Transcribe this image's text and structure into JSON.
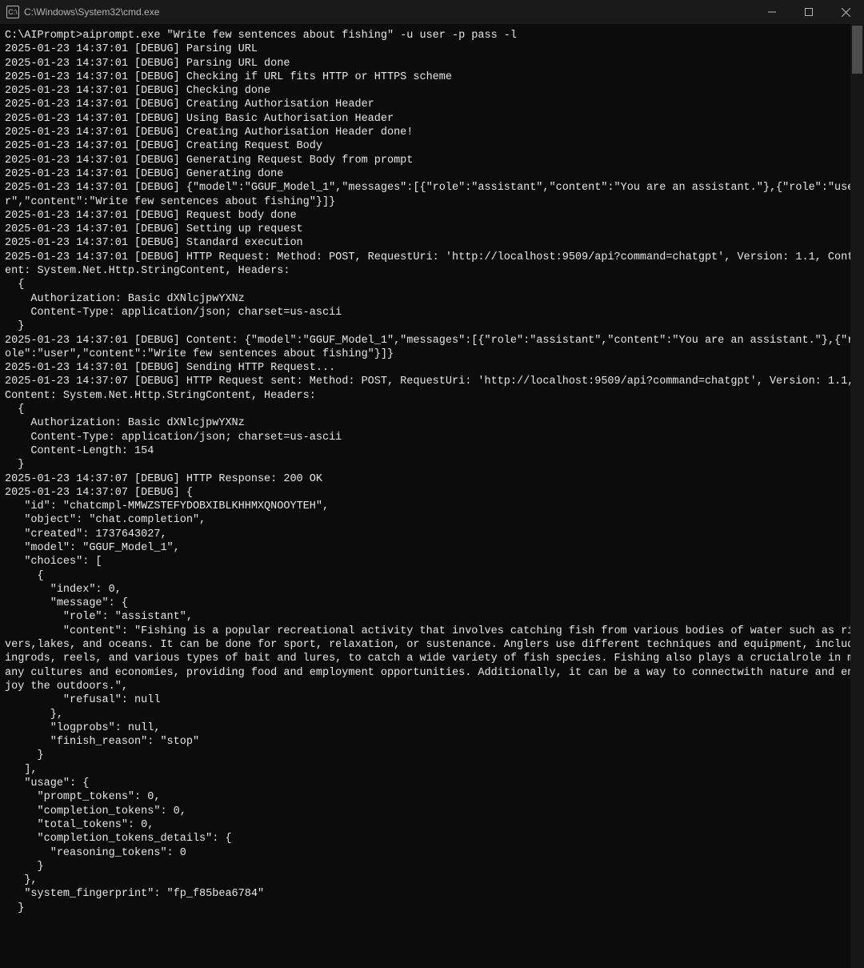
{
  "window": {
    "title": "C:\\Windows\\System32\\cmd.exe",
    "icon_label": "cmd-icon"
  },
  "terminal": {
    "content": "C:\\AIPrompt>aiprompt.exe \"Write few sentences about fishing\" -u user -p pass -l\n2025-01-23 14:37:01 [DEBUG] Parsing URL\n2025-01-23 14:37:01 [DEBUG] Parsing URL done\n2025-01-23 14:37:01 [DEBUG] Checking if URL fits HTTP or HTTPS scheme\n2025-01-23 14:37:01 [DEBUG] Checking done\n2025-01-23 14:37:01 [DEBUG] Creating Authorisation Header\n2025-01-23 14:37:01 [DEBUG] Using Basic Authorisation Header\n2025-01-23 14:37:01 [DEBUG] Creating Authorisation Header done!\n2025-01-23 14:37:01 [DEBUG] Creating Request Body\n2025-01-23 14:37:01 [DEBUG] Generating Request Body from prompt\n2025-01-23 14:37:01 [DEBUG] Generating done\n2025-01-23 14:37:01 [DEBUG] {\"model\":\"GGUF_Model_1\",\"messages\":[{\"role\":\"assistant\",\"content\":\"You are an assistant.\"},{\"role\":\"user\",\"content\":\"Write few sentences about fishing\"}]}\n2025-01-23 14:37:01 [DEBUG] Request body done\n2025-01-23 14:37:01 [DEBUG] Setting up request\n2025-01-23 14:37:01 [DEBUG] Standard execution\n2025-01-23 14:37:01 [DEBUG] HTTP Request: Method: POST, RequestUri: 'http://localhost:9509/api?command=chatgpt', Version: 1.1, Content: System.Net.Http.StringContent, Headers:\n  {\n    Authorization: Basic dXNlcjpwYXNz\n    Content-Type: application/json; charset=us-ascii\n  }\n2025-01-23 14:37:01 [DEBUG] Content: {\"model\":\"GGUF_Model_1\",\"messages\":[{\"role\":\"assistant\",\"content\":\"You are an assistant.\"},{\"role\":\"user\",\"content\":\"Write few sentences about fishing\"}]}\n2025-01-23 14:37:01 [DEBUG] Sending HTTP Request...\n2025-01-23 14:37:07 [DEBUG] HTTP Request sent: Method: POST, RequestUri: 'http://localhost:9509/api?command=chatgpt', Version: 1.1, Content: System.Net.Http.StringContent, Headers:\n  {\n    Authorization: Basic dXNlcjpwYXNz\n    Content-Type: application/json; charset=us-ascii\n    Content-Length: 154\n  }\n2025-01-23 14:37:07 [DEBUG] HTTP Response: 200 OK\n2025-01-23 14:37:07 [DEBUG] {\n   \"id\": \"chatcmpl-MMWZSTEFYDOBXIBLKHHMXQNOOYTEH\",\n   \"object\": \"chat.completion\",\n   \"created\": 1737643027,\n   \"model\": \"GGUF_Model_1\",\n   \"choices\": [\n     {\n       \"index\": 0,\n       \"message\": {\n         \"role\": \"assistant\",\n         \"content\": \"Fishing is a popular recreational activity that involves catching fish from various bodies of water such as rivers,lakes, and oceans. It can be done for sport, relaxation, or sustenance. Anglers use different techniques and equipment, includingrods, reels, and various types of bait and lures, to catch a wide variety of fish species. Fishing also plays a crucialrole in many cultures and economies, providing food and employment opportunities. Additionally, it can be a way to connectwith nature and enjoy the outdoors.\",\n         \"refusal\": null\n       },\n       \"logprobs\": null,\n       \"finish_reason\": \"stop\"\n     }\n   ],\n   \"usage\": {\n     \"prompt_tokens\": 0,\n     \"completion_tokens\": 0,\n     \"total_tokens\": 0,\n     \"completion_tokens_details\": {\n       \"reasoning_tokens\": 0\n     }\n   },\n   \"system_fingerprint\": \"fp_f85bea6784\"\n  }"
  }
}
